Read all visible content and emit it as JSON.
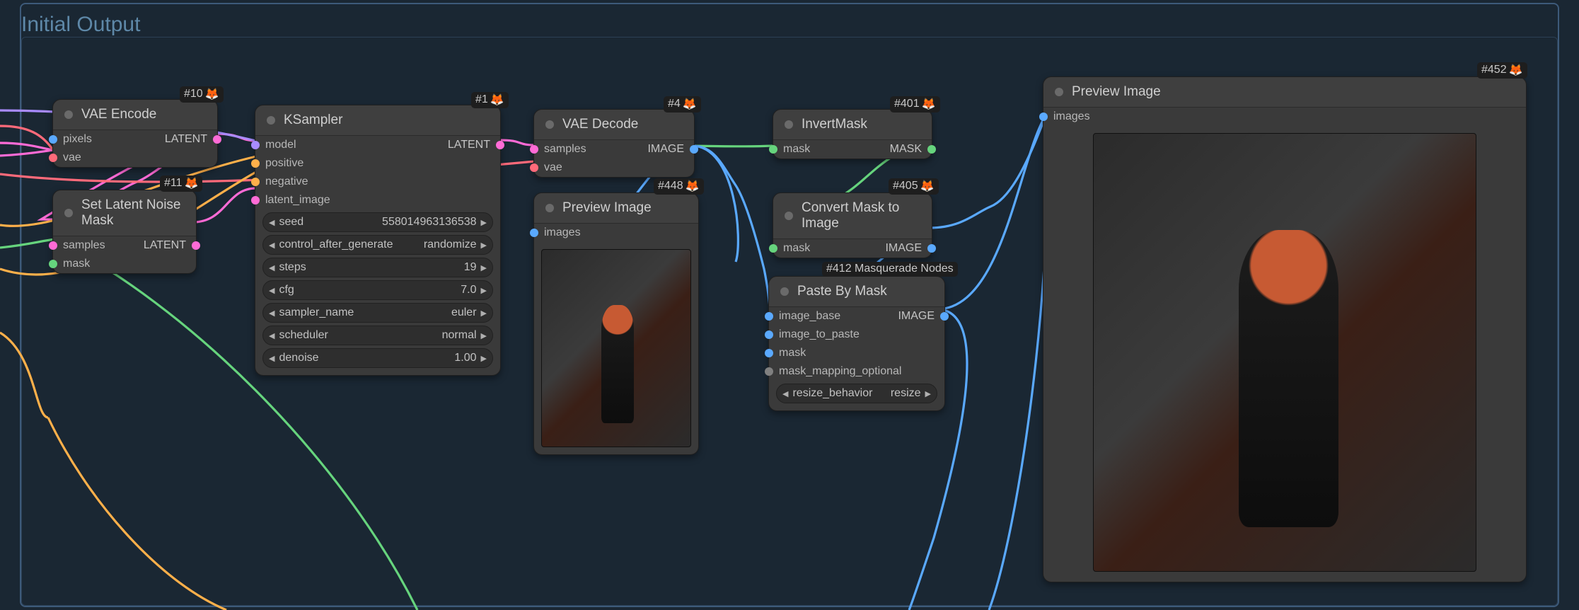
{
  "section": {
    "title": "Initial Output"
  },
  "colors": {
    "latent_pink": "#ff6bd6",
    "image_blue": "#5aa9ff",
    "mask_green": "#66d47d",
    "model_purple": "#a98bff",
    "cond_orange": "#ffb04a",
    "vae_rose": "#ff6a7a",
    "grey": "#808080"
  },
  "tags": {
    "n10": {
      "text": "#10",
      "icon": "🦊"
    },
    "n11": {
      "text": "#11",
      "icon": "🦊"
    },
    "n1": {
      "text": "#1",
      "icon": "🦊"
    },
    "n4": {
      "text": "#4",
      "icon": "🦊"
    },
    "n448": {
      "text": "#448",
      "icon": "🦊"
    },
    "n401": {
      "text": "#401",
      "icon": "🦊"
    },
    "n405": {
      "text": "#405",
      "icon": "🦊"
    },
    "n412": {
      "text": "#412 Masquerade Nodes",
      "icon": ""
    },
    "n452": {
      "text": "#452",
      "icon": "🦊"
    }
  },
  "nodes": {
    "vae_encode": {
      "title": "VAE Encode",
      "inputs": [
        {
          "name": "pixels",
          "color": "image_blue"
        },
        {
          "name": "vae",
          "color": "vae_rose"
        }
      ],
      "outputs": [
        {
          "name": "LATENT",
          "color": "latent_pink"
        }
      ]
    },
    "set_latent_noise_mask": {
      "title": "Set Latent Noise Mask",
      "inputs": [
        {
          "name": "samples",
          "color": "latent_pink"
        },
        {
          "name": "mask",
          "color": "mask_green"
        }
      ],
      "outputs": [
        {
          "name": "LATENT",
          "color": "latent_pink"
        }
      ]
    },
    "ksampler": {
      "title": "KSampler",
      "inputs": [
        {
          "name": "model",
          "color": "model_purple"
        },
        {
          "name": "positive",
          "color": "cond_orange"
        },
        {
          "name": "negative",
          "color": "cond_orange"
        },
        {
          "name": "latent_image",
          "color": "latent_pink"
        }
      ],
      "outputs": [
        {
          "name": "LATENT",
          "color": "latent_pink"
        }
      ],
      "widgets": [
        {
          "name": "seed",
          "value": "558014963136538"
        },
        {
          "name": "control_after_generate",
          "value": "randomize"
        },
        {
          "name": "steps",
          "value": "19"
        },
        {
          "name": "cfg",
          "value": "7.0"
        },
        {
          "name": "sampler_name",
          "value": "euler"
        },
        {
          "name": "scheduler",
          "value": "normal"
        },
        {
          "name": "denoise",
          "value": "1.00"
        }
      ]
    },
    "vae_decode": {
      "title": "VAE Decode",
      "inputs": [
        {
          "name": "samples",
          "color": "latent_pink"
        },
        {
          "name": "vae",
          "color": "vae_rose"
        }
      ],
      "outputs": [
        {
          "name": "IMAGE",
          "color": "image_blue"
        }
      ]
    },
    "preview_448": {
      "title": "Preview Image",
      "inputs": [
        {
          "name": "images",
          "color": "image_blue"
        }
      ]
    },
    "invert_mask": {
      "title": "InvertMask",
      "inputs": [
        {
          "name": "mask",
          "color": "mask_green"
        }
      ],
      "outputs": [
        {
          "name": "MASK",
          "color": "mask_green"
        }
      ]
    },
    "mask_to_image": {
      "title": "Convert Mask to Image",
      "inputs": [
        {
          "name": "mask",
          "color": "mask_green"
        }
      ],
      "outputs": [
        {
          "name": "IMAGE",
          "color": "image_blue"
        }
      ]
    },
    "paste_by_mask": {
      "title": "Paste By Mask",
      "inputs": [
        {
          "name": "image_base",
          "color": "image_blue"
        },
        {
          "name": "image_to_paste",
          "color": "image_blue"
        },
        {
          "name": "mask",
          "color": "image_blue"
        },
        {
          "name": "mask_mapping_optional",
          "color": "grey"
        }
      ],
      "outputs": [
        {
          "name": "IMAGE",
          "color": "image_blue"
        }
      ],
      "widgets": [
        {
          "name": "resize_behavior",
          "value": "resize"
        }
      ]
    },
    "preview_452": {
      "title": "Preview Image",
      "inputs": [
        {
          "name": "images",
          "color": "image_blue"
        }
      ]
    }
  }
}
